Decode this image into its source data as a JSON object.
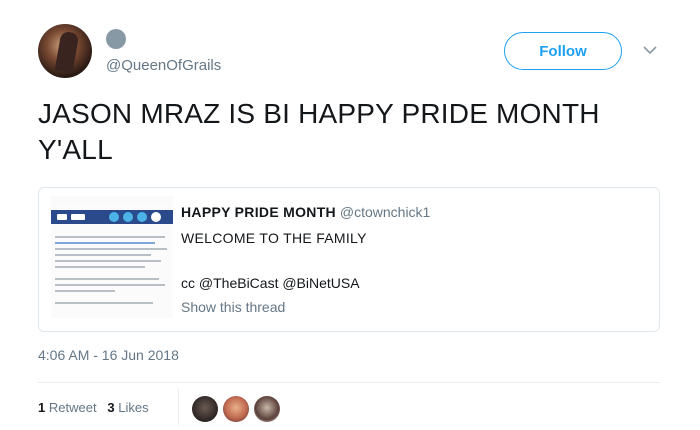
{
  "header": {
    "handle": "@QueenOfGrails",
    "follow_label": "Follow"
  },
  "tweet": {
    "text_line1": "JASON MRAZ IS BI HAPPY PRIDE MONTH",
    "text_line2": "Y'ALL"
  },
  "quoted": {
    "title": "HAPPY PRIDE MONTH",
    "handle": "@ctownchick1",
    "line1": "WELCOME TO THE FAMILY",
    "line2": "cc @TheBiCast @BiNetUSA",
    "link": "Show this thread"
  },
  "meta": {
    "timestamp": "4:06 AM - 16 Jun 2018",
    "retweets_count": "1",
    "retweets_label": "Retweet",
    "likes_count": "3",
    "likes_label": "Likes"
  },
  "icons": {
    "chevron": "chevron-down-icon"
  }
}
